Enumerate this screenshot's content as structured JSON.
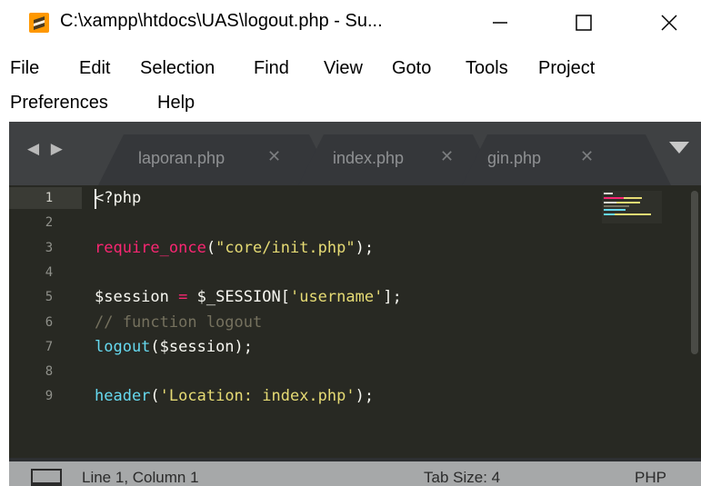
{
  "window": {
    "title": "C:\\xampp\\htdocs\\UAS\\logout.php - Su...",
    "icon": "sublime-text-icon",
    "controls": [
      "minimize-icon",
      "maximize-icon",
      "close-icon"
    ]
  },
  "menu": {
    "items": [
      "File",
      "Edit",
      "Selection",
      "Find",
      "View",
      "Goto",
      "Tools",
      "Project",
      "Preferences",
      "Help"
    ]
  },
  "tabs": {
    "nav_arrows": "◀ ▶",
    "items": [
      {
        "label": "laporan.php",
        "close": "✕"
      },
      {
        "label": "index.php",
        "close": "✕"
      },
      {
        "label": "gin.php",
        "close": "✕"
      }
    ],
    "dropdown_icon": "triangle-down-icon"
  },
  "editor": {
    "line_numbers": [
      "1",
      "2",
      "3",
      "4",
      "5",
      "6",
      "7",
      "8",
      "9"
    ],
    "active_line": "1",
    "lines": [
      [
        {
          "t": "<?php",
          "c": "white"
        }
      ],
      [],
      [
        {
          "t": "require_once",
          "c": "pink"
        },
        {
          "t": "(",
          "c": "white"
        },
        {
          "t": "\"core/init.php\"",
          "c": "yellow"
        },
        {
          "t": ");",
          "c": "white"
        }
      ],
      [],
      [
        {
          "t": "$session ",
          "c": "white"
        },
        {
          "t": "=",
          "c": "pink"
        },
        {
          "t": " $_SESSION[",
          "c": "white"
        },
        {
          "t": "'username'",
          "c": "yellow"
        },
        {
          "t": "];",
          "c": "white"
        }
      ],
      [
        {
          "t": "// function logout",
          "c": "comment"
        }
      ],
      [
        {
          "t": "logout",
          "c": "cyan"
        },
        {
          "t": "($session);",
          "c": "white"
        }
      ],
      [],
      [
        {
          "t": "header",
          "c": "cyan"
        },
        {
          "t": "(",
          "c": "white"
        },
        {
          "t": "'Location: index.php'",
          "c": "yellow"
        },
        {
          "t": ");",
          "c": "white"
        }
      ]
    ]
  },
  "status": {
    "position": "Line 1, Column 1",
    "tab_size": "Tab Size: 4",
    "syntax": "PHP",
    "panel_icon": "panel-toggle-icon"
  },
  "colors": {
    "keyword": "#f92672",
    "function": "#66d9ef",
    "string": "#e6db74",
    "comment": "#75715e",
    "text": "#f8f8f2",
    "background": "#282923"
  }
}
